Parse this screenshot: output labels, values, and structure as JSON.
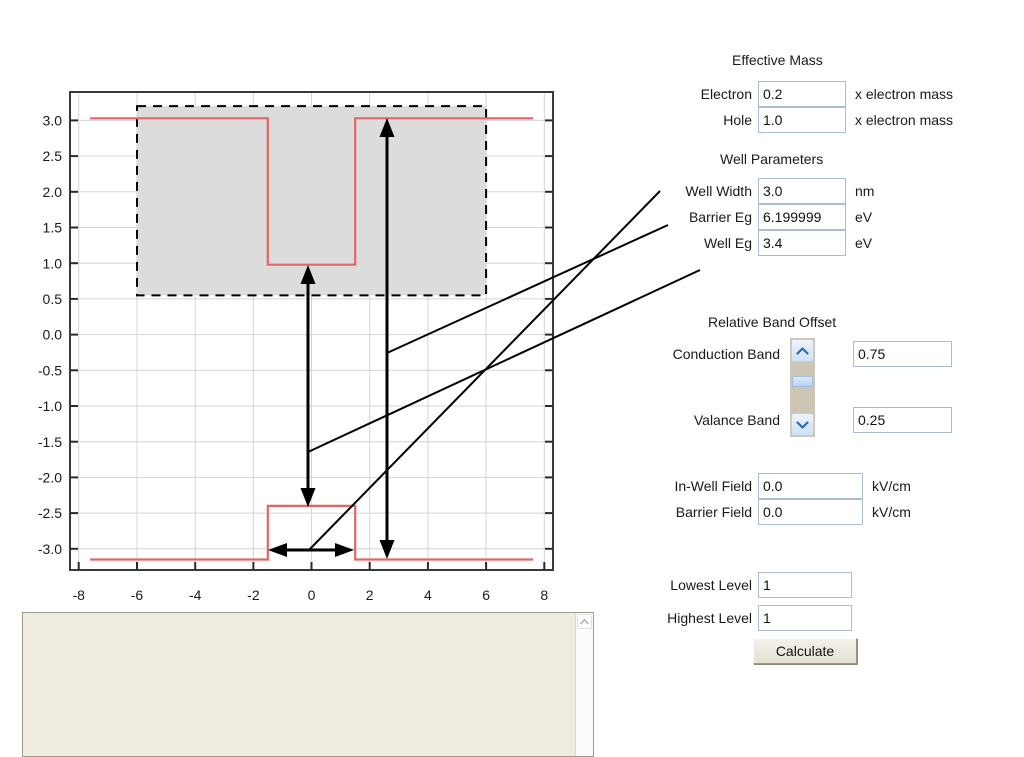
{
  "chart_data": {
    "type": "line",
    "title": "",
    "xlabel": "",
    "ylabel": "",
    "xlim": [
      -8.3,
      8.3
    ],
    "ylim": [
      -3.35,
      3.35
    ],
    "xticks": [
      -8,
      -6,
      -4,
      -2,
      0,
      2,
      4,
      6,
      8
    ],
    "yticks": [
      3.0,
      2.5,
      2.0,
      1.5,
      1.0,
      0.5,
      0.0,
      -0.5,
      -1.0,
      -1.5,
      -2.0,
      -2.5,
      -3.0
    ],
    "grid": true,
    "legend": "none",
    "line_color": "#e06767",
    "series": [
      {
        "name": "conduction-band",
        "comment": "barrier level 3.10 eV, well level 1.05 eV between -1.5 and 1.5 nm",
        "x": [
          -7.6,
          -1.5,
          -1.5,
          1.5,
          1.5,
          7.6
        ],
        "y": [
          3.1,
          3.1,
          1.05,
          1.05,
          3.1,
          3.1
        ]
      },
      {
        "name": "valence-band",
        "comment": "barrier level -3.10 eV, well level -2.35 eV between -1.5 and 1.5 nm",
        "x": [
          -7.6,
          -1.5,
          -1.5,
          1.5,
          1.5,
          7.6
        ],
        "y": [
          -3.1,
          -3.1,
          -2.35,
          -2.35,
          -3.1,
          -3.1
        ]
      }
    ],
    "shaded_region": {
      "name": "barrier-region-box",
      "x_range": [
        -6.0,
        6.0
      ],
      "y_range": [
        0.55,
        3.2
      ],
      "fill": "#dcdcdc",
      "border": "dashed-black"
    },
    "annotations": [
      {
        "name": "well-eg-arrow",
        "label": "Well Eg",
        "type": "double-arrow-vertical",
        "x": 0.0,
        "y_from": 1.05,
        "y_to": -2.35
      },
      {
        "name": "barrier-eg-arrow",
        "label": "Barrier Eg",
        "type": "double-arrow-vertical",
        "x": 2.6,
        "y_from": 3.1,
        "y_to": -3.1
      },
      {
        "name": "well-width-arrow",
        "label": "Well Width",
        "type": "double-arrow-horizontal",
        "y": -2.75,
        "x_from": -1.5,
        "x_to": 1.5
      }
    ]
  },
  "output_panel": {
    "text": "",
    "scroll_up_icon": "chevron-up-icon"
  },
  "controls": {
    "effective_mass": {
      "title": "Effective Mass",
      "rows": [
        {
          "label": "Electron",
          "value": "0.2",
          "unit": "x electron mass"
        },
        {
          "label": "Hole",
          "value": "1.0",
          "unit": "x electron mass"
        }
      ]
    },
    "well_parameters": {
      "title": "Well Parameters",
      "rows": [
        {
          "label": "Well Width",
          "value": "3.0",
          "unit": "nm"
        },
        {
          "label": "Barrier Eg",
          "value": "6.199999",
          "unit": "eV"
        },
        {
          "label": "Well Eg",
          "value": "3.4",
          "unit": "eV"
        }
      ]
    },
    "relative_band_offset": {
      "title": "Relative Band Offset",
      "spinner": {
        "up_icon": "chevron-up-icon",
        "down_icon": "chevron-down-icon"
      },
      "rows": [
        {
          "label": "Conduction Band",
          "value": "0.75"
        },
        {
          "label": "Valance Band",
          "value": "0.25"
        }
      ]
    },
    "fields": {
      "rows": [
        {
          "label": "In-Well Field",
          "value": "0.0",
          "unit": "kV/cm"
        },
        {
          "label": "Barrier Field",
          "value": "0.0",
          "unit": "kV/cm"
        }
      ]
    },
    "levels": {
      "rows": [
        {
          "label": "Lowest Level",
          "value": "1"
        },
        {
          "label": "Highest Level",
          "value": "1"
        }
      ]
    },
    "calculate_label": "Calculate"
  }
}
